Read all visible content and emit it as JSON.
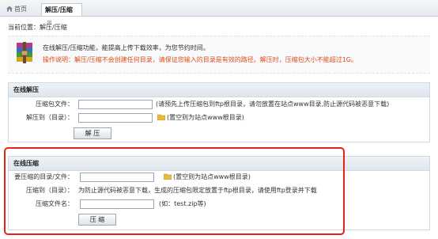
{
  "tabs": {
    "home": "首页",
    "active": "解压/压缩",
    "close": "⊠"
  },
  "breadcrumb": "当前位置：解压/压缩",
  "notice": {
    "line1": "在线解压/压缩功能，能提高上传下载效率，为您节约时间。",
    "line2": "操作说明：解压/压缩不会创建任何目录，请保证您输入的目录是有效的路径。解压时，压缩包大小不能超过1G。"
  },
  "unzip": {
    "title": "在线解压",
    "file_label": "压缩包文件：",
    "file_value": "",
    "file_hint": "(请预先上传压缩包到ftp根目录，请勿放置在站点www目录,防止源代码被恶意下载)",
    "dest_label": "解压到（目录）：",
    "dest_value": "",
    "dest_hint": "(置空则为站点www根目录)",
    "button": "解 压"
  },
  "zip": {
    "title": "在线压缩",
    "src_label": "要压缩的目录/文件：",
    "src_value": "",
    "src_hint": "(置空则为站点www根目录)",
    "dir_label": "压缩到（目录）：",
    "dir_text": "为防止源代码被恶意下载，生成的压缩包限定放置于ftp根目录，请使用ftp登录并下载",
    "name_label": "压缩文件名：",
    "name_value": "",
    "name_hint": "(如：test.zip等)",
    "button": "压 缩"
  },
  "colors": {
    "warning": "#e04b1a",
    "highlight": "#e5231b"
  }
}
